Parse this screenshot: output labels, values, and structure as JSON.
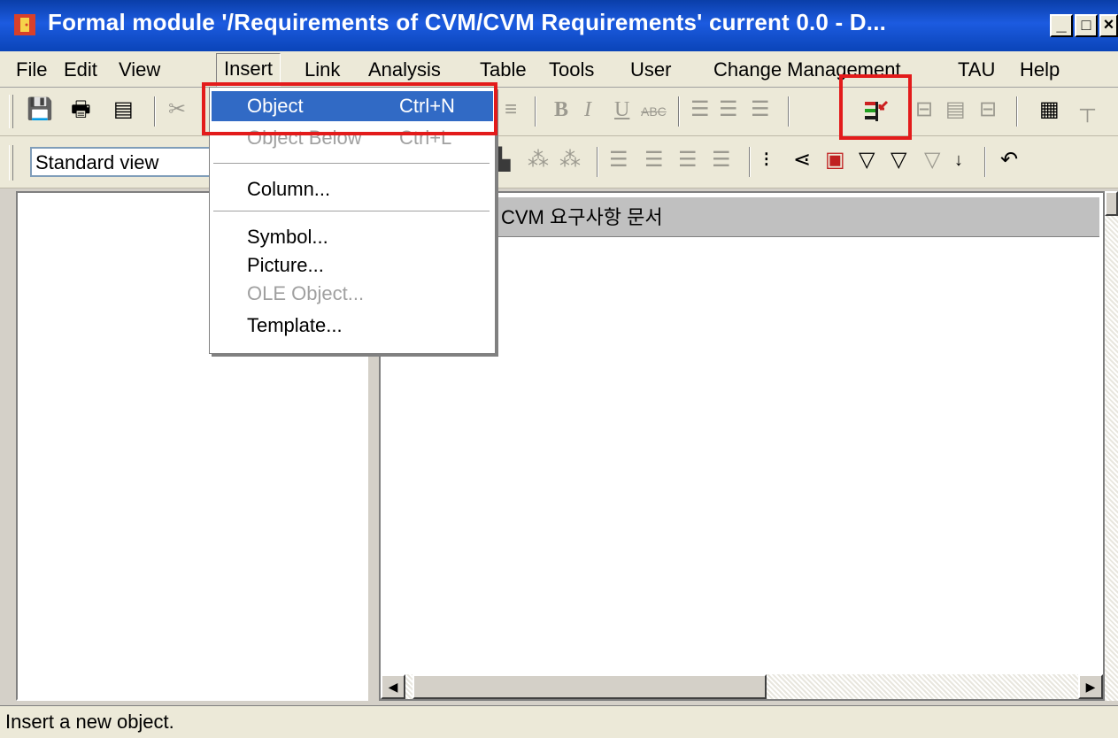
{
  "window": {
    "title": "Formal module '/Requirements of CVM/CVM Requirements' current 0.0 - D...",
    "controls": [
      "_",
      "□",
      "×"
    ]
  },
  "menubar": {
    "items": [
      "File",
      "Edit",
      "View",
      "Insert",
      "Link",
      "Analysis",
      "Table",
      "Tools",
      "User",
      "Change Management",
      "TAU",
      "Help"
    ]
  },
  "toolbar": {
    "view_select": "Standard view"
  },
  "insert_menu": {
    "items": [
      {
        "label": "Object",
        "shortcut": "Ctrl+N",
        "state": "highlighted"
      },
      {
        "label": "Object Below",
        "shortcut": "Ctrl+L",
        "state": "disabled"
      },
      {
        "label": "Column...",
        "state": "enabled"
      },
      {
        "label": "Symbol...",
        "state": "enabled"
      },
      {
        "label": "Picture...",
        "state": "enabled"
      },
      {
        "label": "OLE Object...",
        "state": "disabled"
      },
      {
        "label": "Template...",
        "state": "enabled"
      }
    ]
  },
  "document": {
    "column_header": "CVM 요구사항 문서"
  },
  "statusbar": {
    "text": "Insert a new object."
  },
  "colors": {
    "title_bar": "#1c5be0",
    "menu_highlight": "#316ac5",
    "annotation_red": "#e31b1b",
    "chrome": "#ece9d8"
  },
  "icons": [
    "save-icon",
    "print-icon",
    "properties-icon",
    "cut-icon",
    "insert-object-icon",
    "filter-icon",
    "sort-icon",
    "table-icon"
  ]
}
